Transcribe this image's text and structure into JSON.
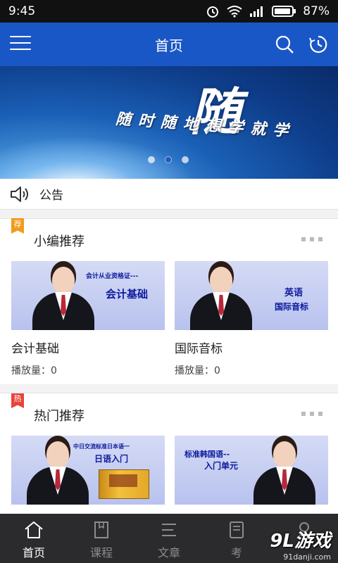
{
  "status": {
    "time": "9:45",
    "battery": "87%"
  },
  "header": {
    "title": "首页"
  },
  "banner": {
    "big_char": "随",
    "slogan": "随时随地想学就学",
    "dots": 3,
    "active_dot": 1
  },
  "notice": {
    "label": "公告"
  },
  "section1": {
    "tag": "荐",
    "title": "小编推荐",
    "cards": [
      {
        "thumb_line1": "会计从业资格证---",
        "thumb_line2": "会计基础",
        "title": "会计基础",
        "plays": "播放量：0"
      },
      {
        "thumb_line1": "英语",
        "thumb_line2": "国际音标",
        "title": "国际音标",
        "plays": "播放量：0"
      }
    ]
  },
  "section2": {
    "tag": "热",
    "title": "热门推荐",
    "cards": [
      {
        "thumb_line1": "中日交流标准日本语一",
        "thumb_line2": "日语入门"
      },
      {
        "thumb_line1": "标准韩国语--",
        "thumb_line2": "入门单元"
      }
    ]
  },
  "nav": {
    "items": [
      {
        "label": "首页",
        "icon": "home-icon"
      },
      {
        "label": "课程",
        "icon": "book-icon"
      },
      {
        "label": "文章",
        "icon": "list-icon"
      },
      {
        "label": "考",
        "icon": "exam-icon"
      },
      {
        "label": "",
        "icon": "user-icon"
      }
    ],
    "active": 0
  },
  "watermark": {
    "main": "9L游戏",
    "sub": "91danji.com"
  },
  "colors": {
    "primary": "#1a57c6",
    "tag_orange": "#f29a1b",
    "tag_red": "#e8433a",
    "nav_bg": "#2b2b2d"
  }
}
